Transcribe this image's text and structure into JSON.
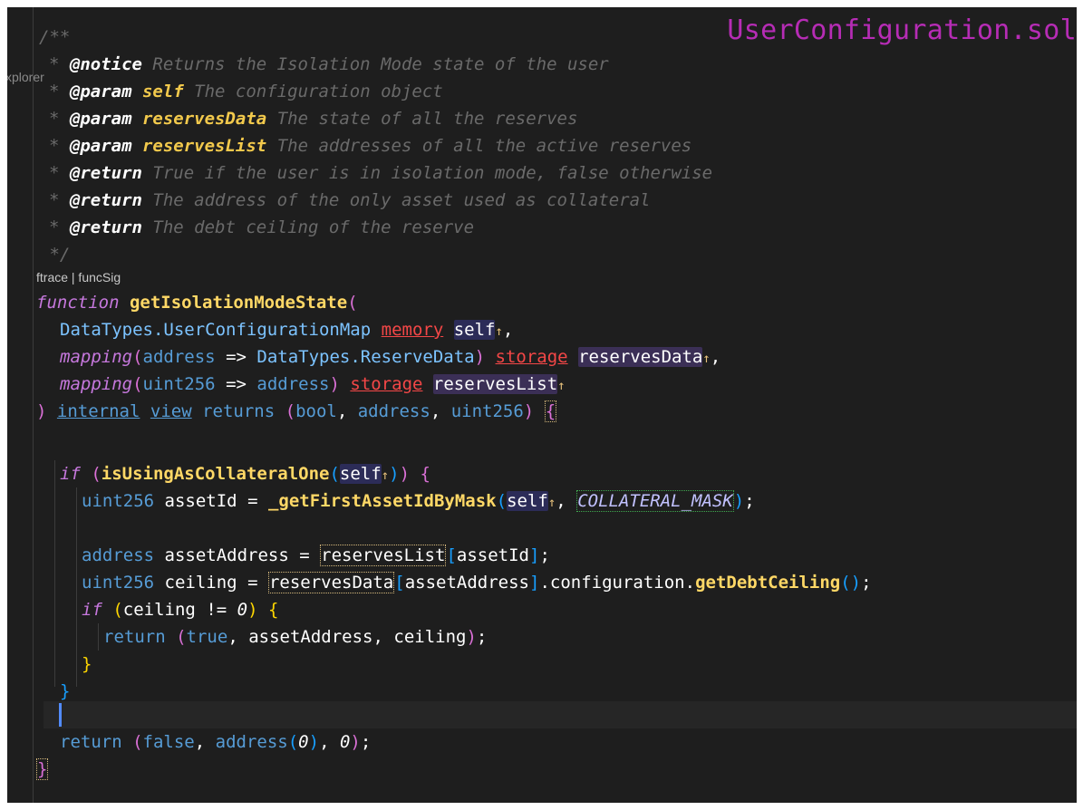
{
  "editor": {
    "filename": "UserConfiguration.sol",
    "explorer_tab": "xplorer",
    "codelens": "ftrace | funcSig"
  },
  "doc_comment": {
    "open": "/**",
    "notice_tag": "@notice",
    "notice_text": " Returns the Isolation Mode state of the user",
    "param1_tag": "@param",
    "param1_name": " self",
    "param1_text": " The configuration object",
    "param2_tag": "@param",
    "param2_name": " reservesData",
    "param2_text": " The state of all the reserves",
    "param3_tag": "@param",
    "param3_name": " reservesList",
    "param3_text": " The addresses of all the active reserves",
    "return1_tag": "@return",
    "return1_text": " True if the user is in isolation mode, false otherwise",
    "return2_tag": "@return",
    "return2_text": " The address of the only asset used as collateral",
    "return3_tag": "@return",
    "return3_text": " The debt ceiling of the reserve",
    "close": " */"
  },
  "code": {
    "function_kw": "function",
    "function_name": "getIsolationModeState",
    "arg1_type": "DataTypes.UserConfigurationMap",
    "memory": "memory",
    "self": "self",
    "mapping": "mapping",
    "address": "address",
    "arrow": "=>",
    "reserve_data_type": "DataTypes.ReserveData",
    "storage": "storage",
    "reserves_data": "reservesData",
    "uint256": "uint256",
    "reserves_list": "reservesList",
    "internal": "internal",
    "view": "view",
    "returns": "returns",
    "bool": "bool",
    "if": "if",
    "is_using_fn": "isUsingAsCollateralOne",
    "asset_id": "assetId",
    "get_first_fn": "_getFirstAssetIdByMask",
    "collateral_mask": "COLLATERAL_MASK",
    "asset_address": "assetAddress",
    "ceiling": "ceiling",
    "configuration": "configuration",
    "get_debt_ceiling_fn": "getDebtCeiling",
    "neq": "!=",
    "zero": "0",
    "return_kw": "return",
    "true": "true",
    "false": "false",
    "assign": "=",
    "ref_marker": "↑"
  }
}
